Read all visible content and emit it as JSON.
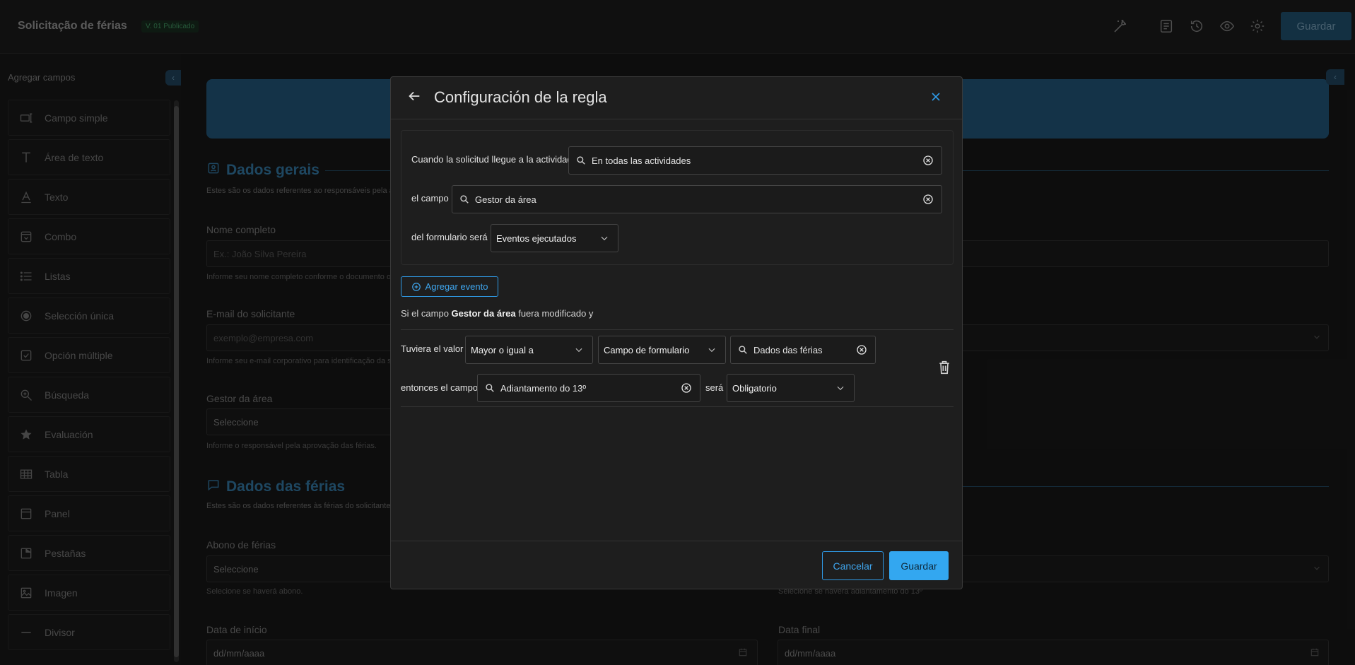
{
  "app": {
    "title": "Solicitação de férias",
    "version": "V. 01 Publicado",
    "save_label": "Guardar"
  },
  "sidebar": {
    "title": "Agregar campos",
    "items": [
      {
        "label": "Campo simple",
        "icon": "input-field-icon"
      },
      {
        "label": "Área de texto",
        "icon": "text-area-icon"
      },
      {
        "label": "Texto",
        "icon": "text-icon"
      },
      {
        "label": "Combo",
        "icon": "combo-icon"
      },
      {
        "label": "Listas",
        "icon": "list-icon"
      },
      {
        "label": "Selección única",
        "icon": "radio-icon"
      },
      {
        "label": "Opción múltiple",
        "icon": "checkbox-icon"
      },
      {
        "label": "Búsqueda",
        "icon": "search-zoom-icon"
      },
      {
        "label": "Evaluación",
        "icon": "star-icon"
      },
      {
        "label": "Tabla",
        "icon": "table-icon"
      },
      {
        "label": "Panel",
        "icon": "panel-icon"
      },
      {
        "label": "Pestañas",
        "icon": "tabs-icon"
      },
      {
        "label": "Imagen",
        "icon": "image-icon"
      },
      {
        "label": "Divisor",
        "icon": "divider-icon"
      }
    ]
  },
  "form": {
    "section1": {
      "title": "Dados gerais",
      "desc": "Estes são os dados referentes ao responsáveis pela aber"
    },
    "nome": {
      "label": "Nome completo",
      "placeholder": "Ex.: João Silva Pereira",
      "help": "Informe seu nome completo conforme o documento ofic"
    },
    "email": {
      "label": "E-mail do solicitante",
      "placeholder": "exemplo@empresa.com",
      "help": "Informe seu e-mail corporativo para identificação da sol"
    },
    "gestor": {
      "label": "Gestor da área",
      "value": "Seleccione",
      "help": "Informe o responsável pela aprovação das férias."
    },
    "section2": {
      "title": "Dados das férias",
      "desc": "Estes são os dados referentes às férias do solicitante."
    },
    "abono": {
      "label": "Abono de férias",
      "value": "Seleccione",
      "help": "Selecione se haverá abono."
    },
    "adiantamento_help": "Selecione se haverá adiantamento do 13º",
    "data_inicio": {
      "label": "Data de início",
      "placeholder": "dd/mm/aaaa"
    },
    "data_final": {
      "label": "Data final",
      "placeholder": "dd/mm/aaaa"
    }
  },
  "modal": {
    "title": "Configuración de la regla",
    "activity_label": "Cuando la solicitud llegue a la actividad",
    "activity_value": "En todas las actividades",
    "field_label": "el campo",
    "field_value": "Gestor da área",
    "form_label": "del formulario será",
    "form_value": "Eventos ejecutados",
    "add_event": "Agregar evento",
    "sentence_prefix": "Si el campo ",
    "sentence_field": "Gestor da área",
    "sentence_suffix": " fuera modificado y",
    "value_label": "Tuviera el valor",
    "operator": "Mayor o igual a",
    "source": "Campo de formulario",
    "source_field": "Dados das férias",
    "then_label": "entonces el campo",
    "target_field": "Adiantamento do 13º",
    "will_be": "será",
    "state": "Obligatorio",
    "cancel": "Cancelar",
    "save": "Guardar"
  },
  "colors": {
    "accent": "#33a7f0",
    "background": "#141414",
    "modal": "#1e1e1e"
  }
}
